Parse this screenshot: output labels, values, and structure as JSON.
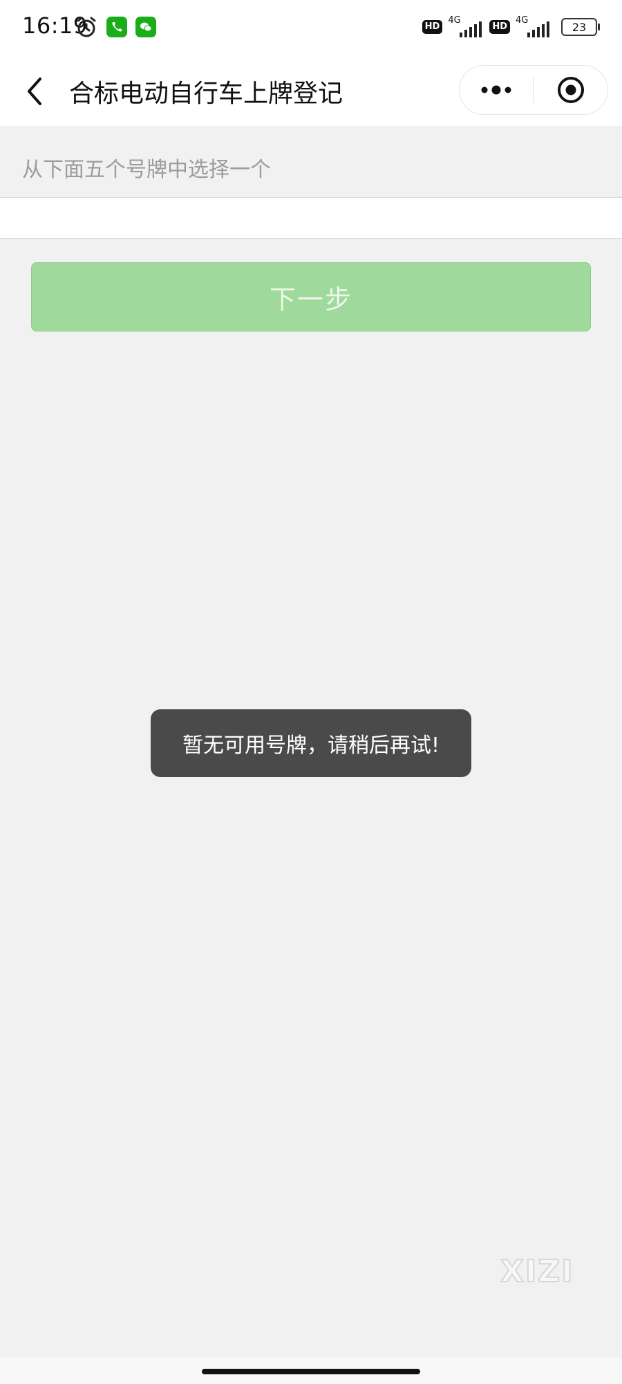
{
  "status_bar": {
    "time": "16:19",
    "network_1": "4G",
    "network_2": "4G",
    "hd_label": "HD",
    "battery_level": "23",
    "app_icon_1": "phone-icon",
    "app_icon_2": "wechat-icon",
    "app_icon_color": "#1aad19"
  },
  "nav": {
    "title": "合标电动自行车上牌登记",
    "back_icon": "chevron-left-icon",
    "more_icon": "more-dots-icon",
    "close_icon": "target-close-icon"
  },
  "main": {
    "section_label": "从下面五个号牌中选择一个",
    "plates": [],
    "next_button_label": "下一步",
    "next_button_color": "#9fd99b"
  },
  "toast": {
    "message": "暂无可用号牌，请稍后再试!"
  },
  "watermark": {
    "text": "XIZI"
  }
}
